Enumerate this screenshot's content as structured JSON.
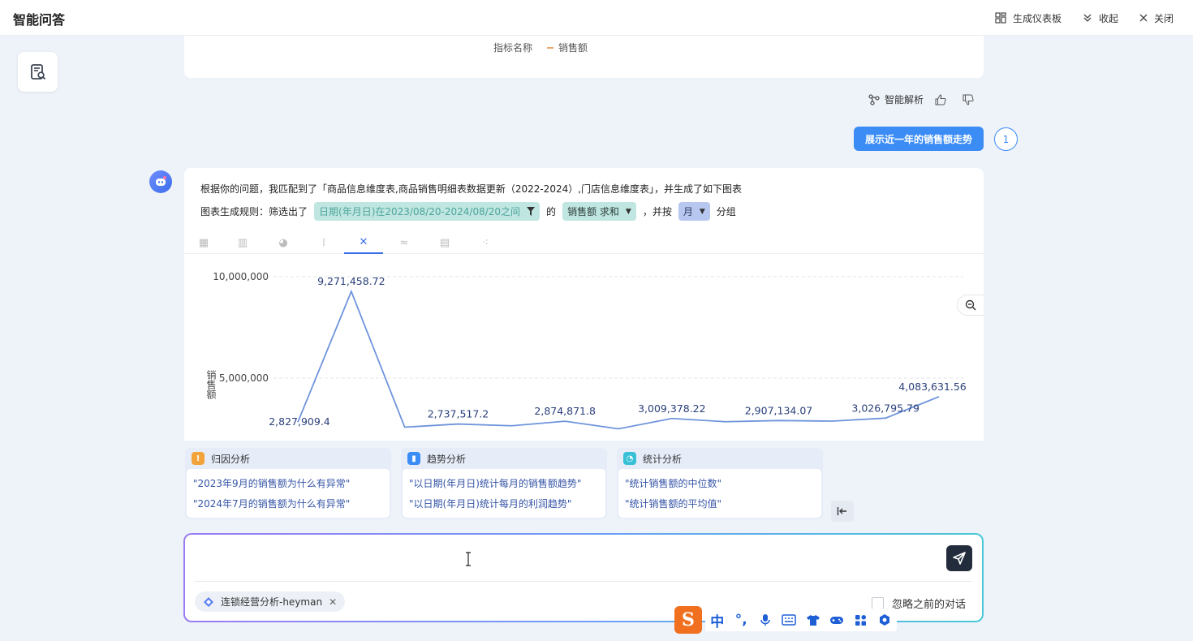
{
  "header": {
    "title": "智能问答",
    "actions": [
      {
        "label": "生成仪表板",
        "icon": "dashboard-icon"
      },
      {
        "label": "收起",
        "icon": "chevron-down-double-icon"
      },
      {
        "label": "关闭",
        "icon": "close-icon"
      }
    ]
  },
  "prev_chart": {
    "legend_title": "指标名称",
    "legend_item": "销售额"
  },
  "feedback": {
    "analyze_label": "智能解析"
  },
  "user_message": {
    "text": "展示近一年的销售额走势",
    "index": "1"
  },
  "answer": {
    "line1": "根据你的问题，我匹配到了「商品信息维度表,商品销售明细表数据更新（2022-2024）,门店信息维度表」，并生成了如下图表",
    "rule_prefix": "图表生成规则：筛选出了",
    "filter_tag": "日期(年月日)在2023/08/20-2024/08/20之间",
    "of_text": "的",
    "metric_tag": "销售额 求和",
    "group_by_text": "，并按",
    "group_tag": "月",
    "group_suffix": "分组"
  },
  "chart_tabs": [
    "table",
    "bar",
    "pie",
    "stacked",
    "line",
    "area",
    "column",
    "scatter"
  ],
  "chart_data": {
    "type": "line",
    "ylabel": "销售额",
    "ylim": [
      0,
      10500000
    ],
    "y_ticks": [
      "10,000,000",
      "5,000,000"
    ],
    "y_tick_values": [
      10000000,
      5000000
    ],
    "series": [
      {
        "name": "销售额",
        "values": [
          2827909.4,
          9271458.72,
          2580000,
          2737517.2,
          2650000,
          2874871.8,
          2500000,
          3009378.22,
          2850000,
          2907134.07,
          2880000,
          3026795.79,
          4083631.56
        ],
        "labels": [
          "2,827,909.4",
          "9,271,458.72",
          "",
          "2,737,517.2",
          "",
          "2,874,871.8",
          "",
          "3,009,378.22",
          "",
          "2,907,134.07",
          "",
          "3,026,795.79",
          "4,083,631.56"
        ]
      }
    ],
    "color": "#6f94dc"
  },
  "suggestions": [
    {
      "title": "归因分析",
      "icon_color": "#f2a33a",
      "icon_glyph": "!",
      "items": [
        "\"2023年9月的销售额为什么有异常\"",
        "\"2024年7月的销售额为什么有异常\""
      ]
    },
    {
      "title": "趋势分析",
      "icon_color": "#3b8cf5",
      "icon_glyph": "▮",
      "items": [
        "\"以日期(年月日)统计每月的销售额趋势\"",
        "\"以日期(年月日)统计每月的利润趋势\""
      ]
    },
    {
      "title": "统计分析",
      "icon_color": "#38c0d6",
      "icon_glyph": "◔",
      "items": [
        "\"统计销售额的中位数\"",
        "\"统计销售额的平均值\""
      ]
    }
  ],
  "input": {
    "value": "",
    "placeholder": "",
    "dataset_chip": "连锁经营分析-heyman",
    "ignore_label": "忽略之前的对话"
  },
  "ime": {
    "logo": "S",
    "mode": "中",
    "punct": "°,"
  }
}
